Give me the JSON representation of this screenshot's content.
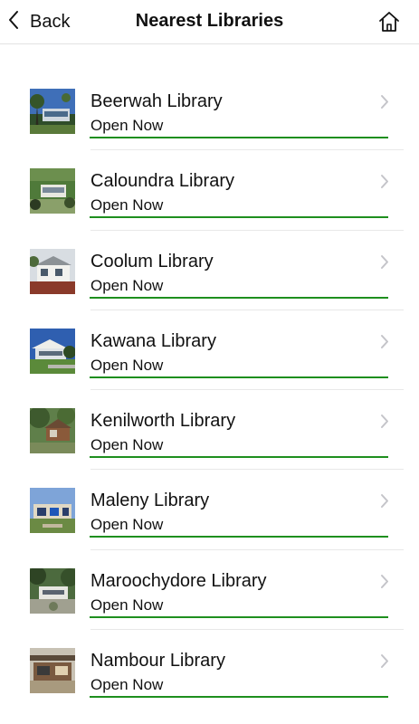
{
  "nav": {
    "back_label": "Back",
    "title": "Nearest Libraries"
  },
  "libraries": [
    {
      "name": "Beerwah Library",
      "status": "Open Now"
    },
    {
      "name": "Caloundra Library",
      "status": "Open Now"
    },
    {
      "name": "Coolum Library",
      "status": "Open Now"
    },
    {
      "name": "Kawana Library",
      "status": "Open Now"
    },
    {
      "name": "Kenilworth Library",
      "status": "Open Now"
    },
    {
      "name": "Maleny Library",
      "status": "Open Now"
    },
    {
      "name": "Maroochydore Library",
      "status": "Open Now"
    },
    {
      "name": "Nambour Library",
      "status": "Open Now"
    }
  ],
  "icons": {
    "back": "chevron-left-icon",
    "home": "home-icon",
    "row": "chevron-right-icon"
  },
  "colors": {
    "status_bar": "#1e8f1e",
    "chevron": "#c4c4c9"
  }
}
